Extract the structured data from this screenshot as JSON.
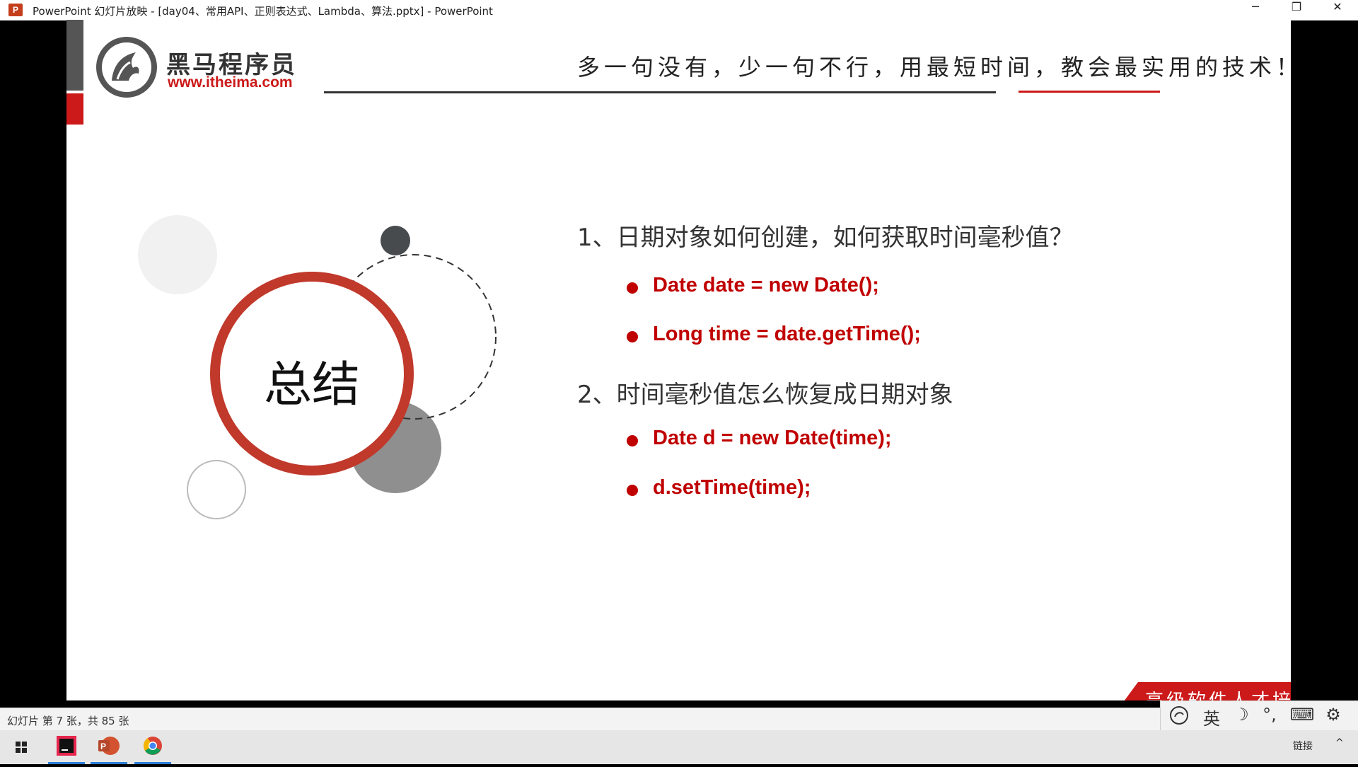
{
  "window": {
    "title": "PowerPoint 幻灯片放映 - [day04、常用API、正则表达式、Lambda、算法.pptx] - PowerPoint",
    "app_icon_letter": "P",
    "minimize": "─",
    "restore": "❐",
    "close": "✕"
  },
  "header": {
    "logo_name": "黑马程序员",
    "logo_url": "www.itheima.com",
    "slogan": "多一句没有，少一句不行，用最短时间，教会最实用的技术！"
  },
  "slide": {
    "circle_title": "总结",
    "q1": "1、日期对象如何创建，如何获取时间毫秒值？",
    "q1_bullets": [
      "Date date = new Date();",
      "Long time = date.getTime();"
    ],
    "q2": "2、时间毫秒值怎么恢复成日期对象",
    "q2_bullets": [
      "Date d = new Date(time);",
      "d.setTime(time);"
    ],
    "footer_tagline": "高级软件人才培训专家"
  },
  "status": {
    "slide_position": "幻灯片 第 7 张，共 85 张"
  },
  "ime": {
    "lang": "英",
    "moon": "☽",
    "punct": "°,",
    "keyboard": "⌨",
    "settings": "⚙"
  },
  "taskbar": {
    "tray_link": "链接",
    "tray_up": "^"
  },
  "colors": {
    "accent_red": "#cc1919",
    "text_red": "#c00000",
    "dark_gray": "#555555"
  }
}
